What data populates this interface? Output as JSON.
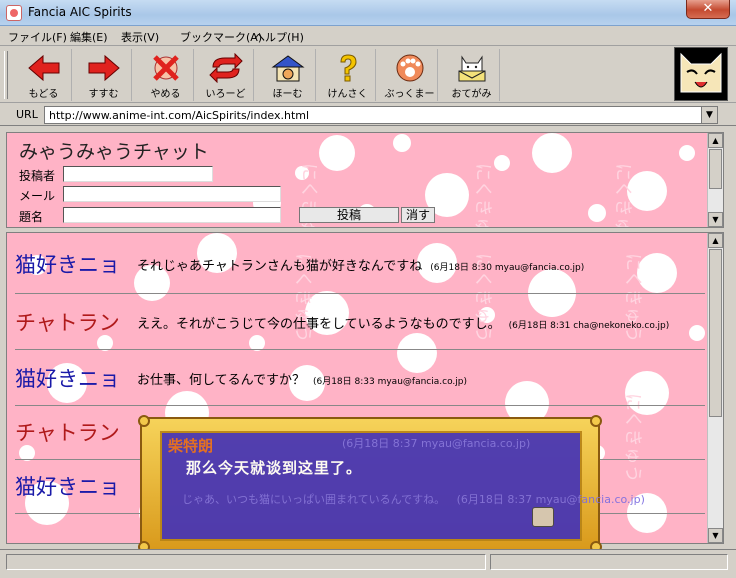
{
  "window": {
    "title": "Fancia AIC Spirits",
    "close_label": "✕"
  },
  "menu": [
    {
      "label": "ファイル(F)"
    },
    {
      "label": "編集(E)"
    },
    {
      "label": "表示(V)"
    },
    {
      "label": "ブックマーク(A)"
    },
    {
      "label": "ヘルプ(H)"
    }
  ],
  "toolbar": [
    {
      "label": "もどる",
      "icon": "back-arrow-icon"
    },
    {
      "label": "すすむ",
      "icon": "forward-arrow-icon"
    },
    {
      "label": "やめる",
      "icon": "stop-icon"
    },
    {
      "label": "いろーど",
      "icon": "reload-icon"
    },
    {
      "label": "ほーむ",
      "icon": "home-icon"
    },
    {
      "label": "けんさく",
      "icon": "search-icon"
    },
    {
      "label": "ぶっくまーく",
      "icon": "bookmark-paw-icon"
    },
    {
      "label": "おてがみ",
      "icon": "mail-cat-icon"
    }
  ],
  "url": {
    "label": "URL",
    "value": "http://www.anime-int.com/AicSpirits/index.html"
  },
  "chat": {
    "title": "みゃうみゃうチャット",
    "fields": [
      "投稿者",
      "メール",
      "題名"
    ],
    "submit_label": "投稿",
    "clear_label": "消す"
  },
  "messages": [
    {
      "speaker": "猫好きニョ",
      "color": "#1a1aa8",
      "text": "それじゃあチャトランさんも猫が好きなんですね",
      "meta": "(6月18日 8:30 myau@fancia.co.jp)"
    },
    {
      "speaker": "チャトラン",
      "color": "#b01a1a",
      "text": "ええ。それがこうじて今の仕事をしているようなものですし。",
      "meta": "(6月18日 8:31 cha@nekoneko.co.jp)"
    },
    {
      "speaker": "猫好きニョ",
      "color": "#1a1aa8",
      "text": "お仕事、何してるんですか？",
      "meta": "(6月18日 8:33 myau@fancia.co.jp)"
    },
    {
      "speaker": "チャトラン",
      "color": "#b01a1a",
      "text": "",
      "meta": ""
    },
    {
      "speaker": "猫好きニョ",
      "color": "#1a1aa8",
      "text": "",
      "meta": ""
    }
  ],
  "dialog": {
    "speaker": "柴特朗",
    "text": "那么今天就谈到这里了。",
    "ghost_line": "じゃあ、いつも猫にいっぱい囲まれているんですね。",
    "ghost_meta": "(6月18日 8:37 myau@fancia.co.jp)"
  },
  "background_text": "にくきゅう",
  "colors": {
    "accent_pink": "#ffb3c6",
    "dialog_blue": "#4634b6",
    "gold": "#f3c94a"
  }
}
